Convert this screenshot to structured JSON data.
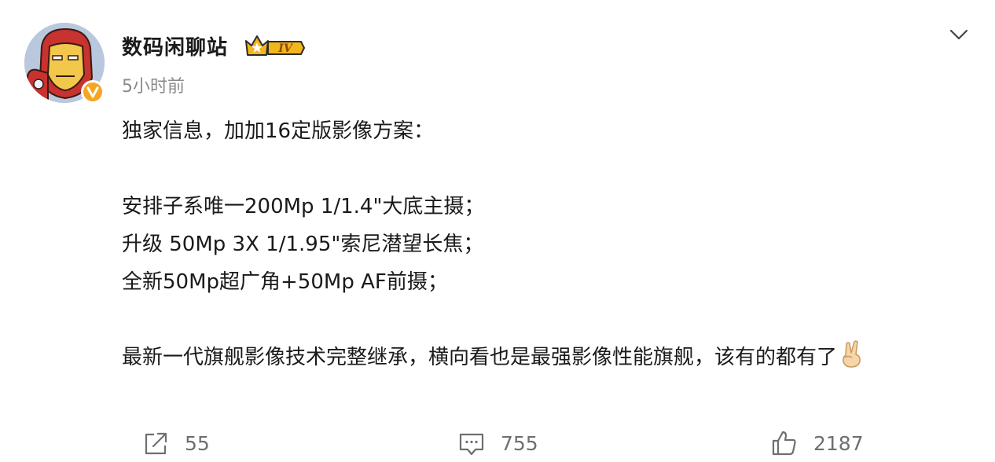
{
  "post": {
    "author": "数码闲聊站",
    "level_badge": "IV",
    "time": "5小时前",
    "lines": [
      "独家信息，加加16定版影像方案：",
      "",
      "安排子系唯一200Mp 1/1.4\"大底主摄；",
      "升级 50Mp 3X 1/1.95\"索尼潜望长焦；",
      "全新50Mp超广角+50Mp AF前摄；",
      "",
      "最新一代旗舰影像技术完整继承，横向看也是最强影像性能旗舰，该有的都有了"
    ],
    "emoji": "victory-hand-emoji"
  },
  "actions": {
    "share_count": "55",
    "comment_count": "755",
    "like_count": "2187"
  },
  "colors": {
    "text": "#1a1a1a",
    "muted": "#8a8a8a",
    "icon": "#6f6f6f",
    "verified_badge": "#f4a623",
    "level_badge": "#f3b51c"
  }
}
